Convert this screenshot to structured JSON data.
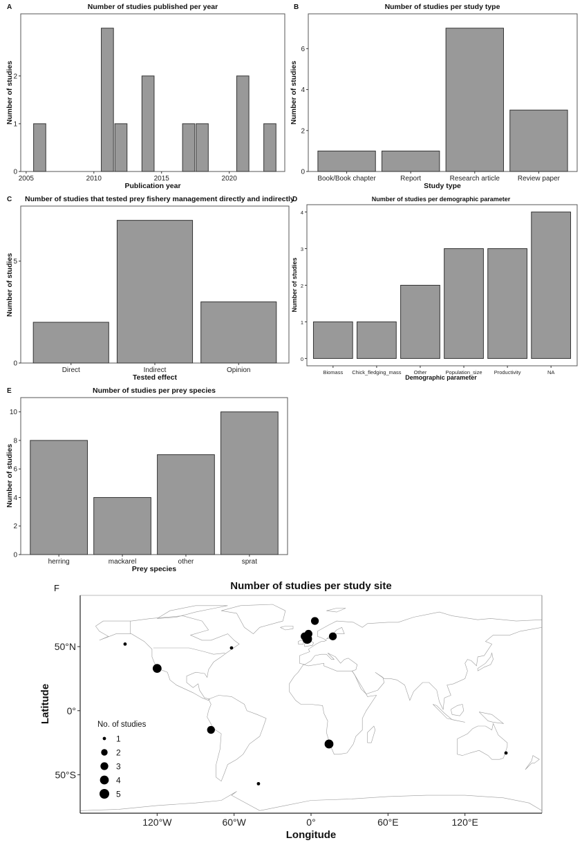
{
  "chart_data": [
    {
      "panel": "A",
      "type": "bar",
      "title": "Number of studies published per year",
      "xlabel": "Publication year",
      "ylabel": "Number of studies",
      "x": [
        2006,
        2011,
        2012,
        2014,
        2017,
        2018,
        2021,
        2023
      ],
      "values": [
        1,
        3,
        1,
        2,
        1,
        1,
        2,
        1
      ],
      "xlim": [
        2004.6,
        2024.1
      ],
      "ylim": [
        0,
        3.3
      ],
      "xticks": [
        2005,
        2010,
        2015,
        2020
      ],
      "yticks": [
        0,
        1,
        2
      ],
      "grid": false
    },
    {
      "panel": "B",
      "type": "bar",
      "title": "Number of studies per study type",
      "xlabel": "Study type",
      "ylabel": "Number of studies",
      "categories": [
        "Book/Book chapter",
        "Report",
        "Research article",
        "Review paper"
      ],
      "values": [
        1,
        1,
        7,
        3
      ],
      "ylim": [
        0,
        7.7
      ],
      "yticks": [
        0,
        2,
        4,
        6
      ],
      "grid": false
    },
    {
      "panel": "C",
      "type": "bar",
      "title": "Number of studies that tested prey fishery management directly and indirectly",
      "xlabel": "Tested effect",
      "ylabel": "Number of studies",
      "categories": [
        "Direct",
        "Indirect",
        "Opinion"
      ],
      "values": [
        2,
        7,
        3
      ],
      "ylim": [
        0,
        7.7
      ],
      "yticks": [
        0,
        5
      ],
      "grid": false
    },
    {
      "panel": "D",
      "type": "bar",
      "title": "Number of studies per demographic parameter",
      "xlabel": "Demographic parameter",
      "ylabel": "Number of studies",
      "categories": [
        "Biomass",
        "Chick_fledging_mass",
        "Other",
        "Population_size",
        "Productivity",
        "NA"
      ],
      "values": [
        1,
        1,
        2,
        3,
        3,
        4
      ],
      "ylim": [
        -0.2,
        4.2
      ],
      "yticks": [
        0,
        1,
        2,
        3,
        4
      ],
      "grid": false
    },
    {
      "panel": "E",
      "type": "bar",
      "title": "Number of studies per prey species",
      "xlabel": "Prey species",
      "ylabel": "Number of studies",
      "categories": [
        "herring",
        "mackarel",
        "other",
        "sprat"
      ],
      "values": [
        8,
        4,
        7,
        10
      ],
      "ylim": [
        0,
        11
      ],
      "yticks": [
        0,
        2,
        4,
        6,
        8,
        10
      ],
      "grid": false
    },
    {
      "panel": "F",
      "type": "scatter",
      "title": "Number of studies per study site",
      "xlabel": "Longitude",
      "ylabel": "Latitude",
      "xlim": [
        -180,
        180
      ],
      "ylim": [
        -80,
        90
      ],
      "xticks": [
        {
          "value": -120,
          "label": "120°W"
        },
        {
          "value": -60,
          "label": "60°W"
        },
        {
          "value": 0,
          "label": "0°"
        },
        {
          "value": 60,
          "label": "60°E"
        },
        {
          "value": 120,
          "label": "120°E"
        }
      ],
      "yticks": [
        {
          "value": 50,
          "label": "50°N"
        },
        {
          "value": 0,
          "label": "0°"
        },
        {
          "value": -50,
          "label": "50°S"
        }
      ],
      "legend": {
        "title": "No. of studies",
        "entries": [
          1,
          2,
          3,
          4,
          5
        ],
        "placement": "bottom-left (inside)"
      },
      "points": [
        {
          "lon": -145,
          "lat": 52,
          "n": 1
        },
        {
          "lon": -120,
          "lat": 33,
          "n": 4
        },
        {
          "lon": -62,
          "lat": 49,
          "n": 1
        },
        {
          "lon": -78,
          "lat": -15,
          "n": 3
        },
        {
          "lon": -41,
          "lat": -57,
          "n": 1
        },
        {
          "lon": 3,
          "lat": 70,
          "n": 3
        },
        {
          "lon": -5,
          "lat": 58,
          "n": 3
        },
        {
          "lon": -2,
          "lat": 60,
          "n": 3
        },
        {
          "lon": -3,
          "lat": 56,
          "n": 5
        },
        {
          "lon": 17,
          "lat": 58,
          "n": 3
        },
        {
          "lon": 14,
          "lat": -26,
          "n": 4
        },
        {
          "lon": 152,
          "lat": -33,
          "n": 1
        }
      ]
    }
  ],
  "panel_labels": [
    "A",
    "B",
    "C",
    "D",
    "E",
    "F"
  ],
  "colors": {
    "bar_fill": "#999999",
    "bar_stroke": "#333333",
    "dot": "#000000",
    "coast": "#9a9a9a"
  }
}
